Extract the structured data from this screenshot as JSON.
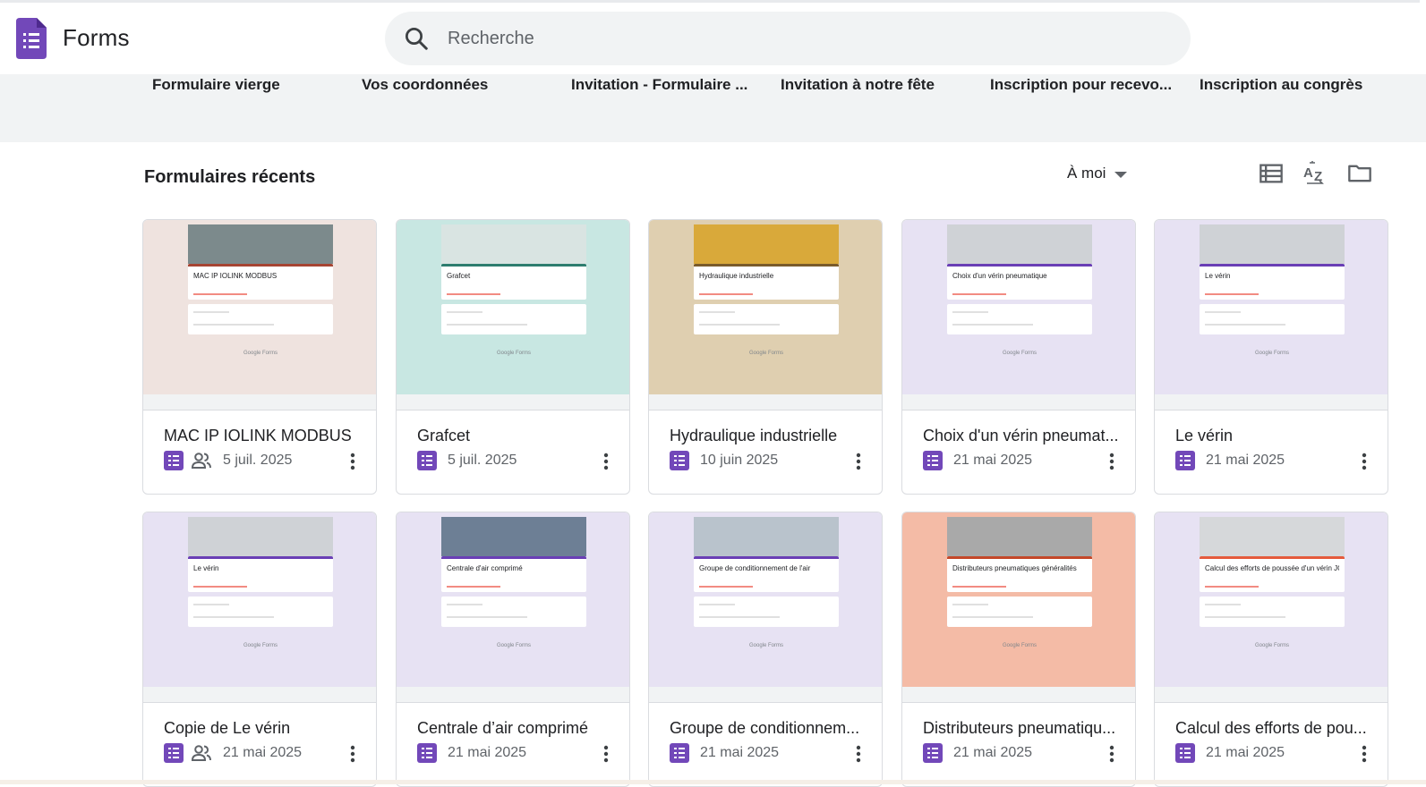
{
  "app": {
    "title": "Forms"
  },
  "search": {
    "placeholder": "Recherche"
  },
  "templates": [
    "Formulaire vierge",
    "Vos coordonnées",
    "Invitation - Formulaire ...",
    "Invitation à notre fête",
    "Inscription pour recevo...",
    "Inscription au congrès"
  ],
  "recent": {
    "title": "Formulaires récents",
    "owner_filter": "À moi"
  },
  "cards": [
    {
      "title": "MAC IP IOLINK MODBUS",
      "date": "5 juil. 2025",
      "shared": true,
      "thumb_title": "MAC IP IOLINK MODBUS",
      "bg": "#efe3df",
      "accent": "#a64433",
      "banner": "#7c8a8c"
    },
    {
      "title": "Grafcet",
      "date": "5 juil. 2025",
      "shared": false,
      "thumb_title": "Grafcet",
      "bg": "#c8e7e2",
      "accent": "#2e7d6f",
      "banner": "#d9e4e2"
    },
    {
      "title": "Hydraulique industrielle",
      "date": "10 juin 2025",
      "shared": false,
      "thumb_title": "Hydraulique industrielle",
      "bg": "#dfcfb0",
      "accent": "#7a5b2b",
      "banner": "#d9a93a"
    },
    {
      "title": "Choix d'un vérin pneumat...",
      "date": "21 mai 2025",
      "shared": false,
      "thumb_title": "Choix d'un vérin pneumatique",
      "bg": "#e7e2f3",
      "accent": "#6a3fb5",
      "banner": "#cfd2d6"
    },
    {
      "title": "Le vérin",
      "date": "21 mai 2025",
      "shared": false,
      "thumb_title": "Le vérin",
      "bg": "#e7e2f3",
      "accent": "#6a3fb5",
      "banner": "#cfd2d6"
    },
    {
      "title": "Copie de Le vérin",
      "date": "21 mai 2025",
      "shared": true,
      "thumb_title": "Le vérin",
      "bg": "#e7e2f3",
      "accent": "#6a3fb5",
      "banner": "#cfd2d6"
    },
    {
      "title": "Centrale d’air comprimé",
      "date": "21 mai 2025",
      "shared": false,
      "thumb_title": "Centrale d'air comprimé",
      "bg": "#e7e2f3",
      "accent": "#6a3fb5",
      "banner": "#6d7f95"
    },
    {
      "title": "Groupe de conditionnem...",
      "date": "21 mai 2025",
      "shared": false,
      "thumb_title": "Groupe de conditionnement de l'air",
      "bg": "#e7e2f3",
      "accent": "#6a3fb5",
      "banner": "#b9c3cc"
    },
    {
      "title": "Distributeurs pneumatiqu...",
      "date": "21 mai 2025",
      "shared": false,
      "thumb_title": "Distributeurs pneumatiques généralités",
      "bg": "#f4bba6",
      "accent": "#c4482a",
      "banner": "#a9a9a9"
    },
    {
      "title": "Calcul des efforts de pou...",
      "date": "21 mai 2025",
      "shared": false,
      "thumb_title": "Calcul des efforts de poussée d'un vérin JOUCOMATIC",
      "bg": "#e7e2f3",
      "accent": "#e55b3c",
      "banner": "#d6d8da"
    }
  ],
  "thumb_footer": "Google Forms",
  "colors": {
    "brand": "#7248b9",
    "search_bg": "#f1f3f4",
    "templates_bg": "#f1f3f4"
  }
}
